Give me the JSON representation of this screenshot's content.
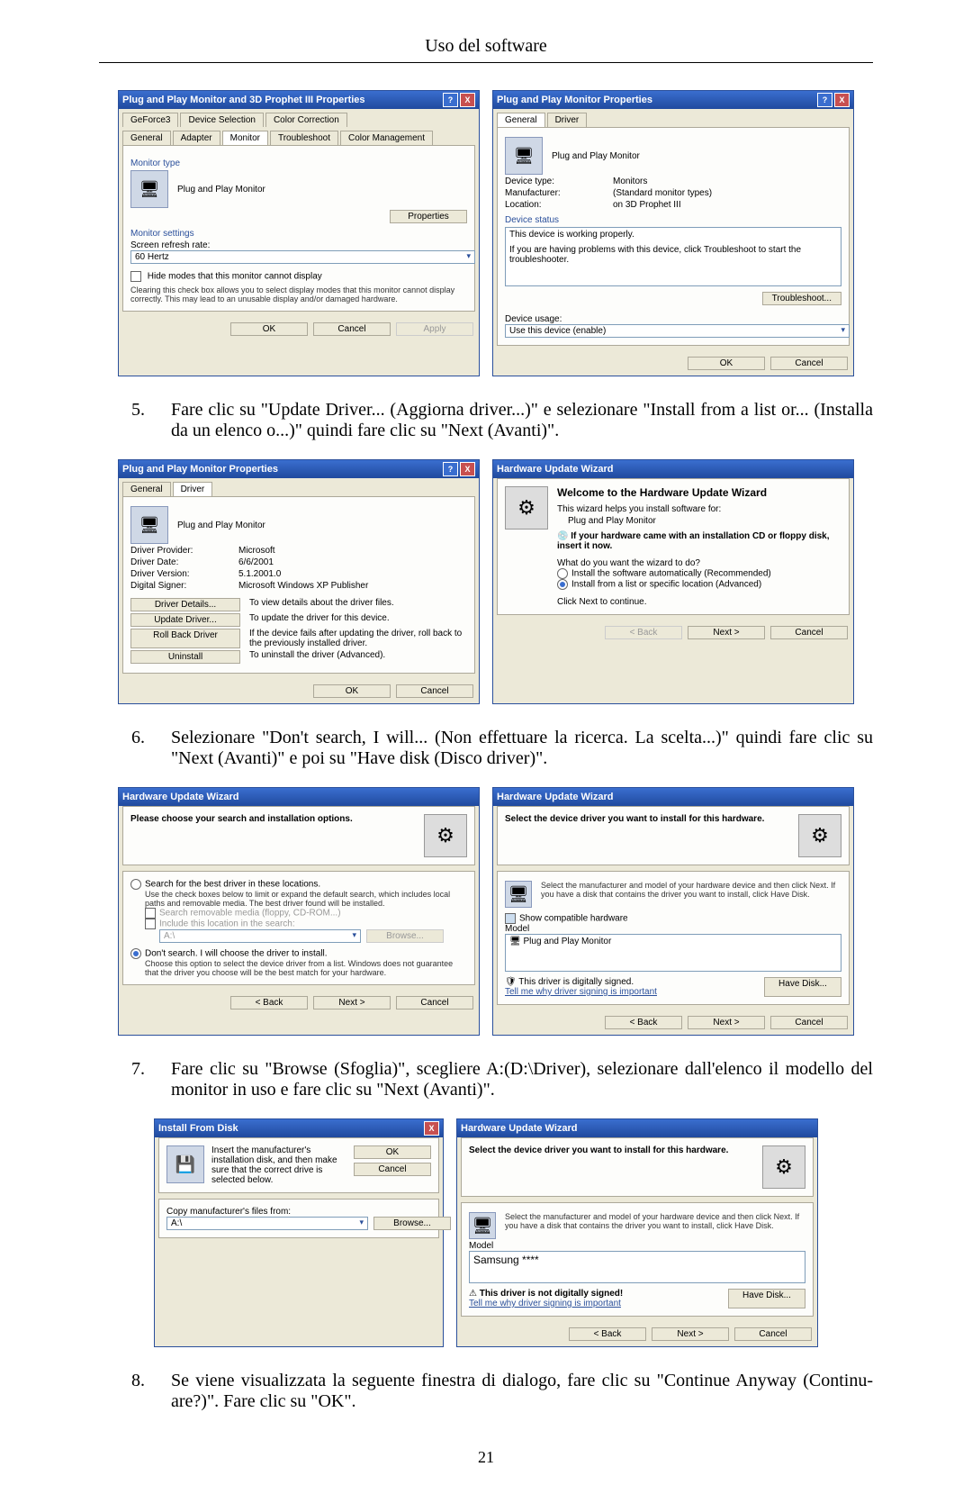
{
  "doc": {
    "header": "Uso del software",
    "page_number": "21"
  },
  "steps": {
    "s5": {
      "num": "5.",
      "text": "Fare clic su \"Update Driver... (Aggiorna driver...)\" e selezionare \"Install from a list or... (Installa da un elenco o...)\" quindi fare clic su \"Next (Avanti)\"."
    },
    "s6": {
      "num": "6.",
      "text": "Selezionare \"Don't search, I will... (Non effettuare la ricerca. La scelta...)\" quindi fare clic su \"Next (Avanti)\" e poi su \"Have disk (Disco driver)\"."
    },
    "s7": {
      "num": "7.",
      "text": "Fare clic su \"Browse (Sfoglia)\", scegliere A:(D:\\Driver), selezionare dall'elenco il modello del monitor in uso e fare clic su \"Next (Avanti)\"."
    },
    "s8": {
      "num": "8.",
      "text": "Se viene visualizzata la seguente finestra di dialogo, fare clic su \"Continue Anyway (Continu-are?)\". Fare clic su \"OK\"."
    }
  },
  "common": {
    "ok": "OK",
    "cancel": "Cancel",
    "apply": "Apply",
    "back": "< Back",
    "next": "Next >",
    "browse": "Browse...",
    "have_disk": "Have Disk...",
    "x": "X",
    "help": "?"
  },
  "win1a": {
    "title": "Plug and Play Monitor and 3D Prophet III Properties",
    "tabs_top": [
      "GeForce3",
      "Device Selection",
      "Color Correction"
    ],
    "tabs_bot": [
      "General",
      "Adapter",
      "Monitor",
      "Troubleshoot",
      "Color Management"
    ],
    "monitor_type_label": "Monitor type",
    "monitor_name": "Plug and Play Monitor",
    "properties_btn": "Properties",
    "settings_label": "Monitor settings",
    "refresh_label": "Screen refresh rate:",
    "refresh_value": "60 Hertz",
    "hide_modes": "Hide modes that this monitor cannot display",
    "hide_note": "Clearing this check box allows you to select display modes that this monitor cannot display correctly. This may lead to an unusable display and/or damaged hardware."
  },
  "win1b": {
    "title": "Plug and Play Monitor Properties",
    "tabs": [
      "General",
      "Driver"
    ],
    "device_name": "Plug and Play Monitor",
    "type_lbl": "Device type:",
    "type_val": "Monitors",
    "mfr_lbl": "Manufacturer:",
    "mfr_val": "(Standard monitor types)",
    "loc_lbl": "Location:",
    "loc_val": "on 3D Prophet III",
    "status_label": "Device status",
    "status_text": "This device is working properly.",
    "status_help": "If you are having problems with this device, click Troubleshoot to start the troubleshooter.",
    "troubleshoot": "Troubleshoot...",
    "usage_label": "Device usage:",
    "usage_value": "Use this device (enable)"
  },
  "win2a": {
    "title": "Plug and Play Monitor Properties",
    "tabs": [
      "General",
      "Driver"
    ],
    "device_name": "Plug and Play Monitor",
    "prov_lbl": "Driver Provider:",
    "prov_val": "Microsoft",
    "date_lbl": "Driver Date:",
    "date_val": "6/6/2001",
    "ver_lbl": "Driver Version:",
    "ver_val": "5.1.2001.0",
    "sign_lbl": "Digital Signer:",
    "sign_val": "Microsoft Windows XP Publisher",
    "details_btn": "Driver Details...",
    "details_txt": "To view details about the driver files.",
    "update_btn": "Update Driver...",
    "update_txt": "To update the driver for this device.",
    "roll_btn": "Roll Back Driver",
    "roll_txt": "If the device fails after updating the driver, roll back to the previously installed driver.",
    "uninst_btn": "Uninstall",
    "uninst_txt": "To uninstall the driver (Advanced)."
  },
  "win2b": {
    "title": "Hardware Update Wizard",
    "heading": "Welcome to the Hardware Update Wizard",
    "intro": "This wizard helps you install software for:",
    "device": "Plug and Play Monitor",
    "cd_hint": "If your hardware came with an installation CD or floppy disk, insert it now.",
    "question": "What do you want the wizard to do?",
    "opt1": "Install the software automatically (Recommended)",
    "opt2": "Install from a list or specific location (Advanced)",
    "click_next": "Click Next to continue."
  },
  "win3a": {
    "title": "Hardware Update Wizard",
    "heading": "Please choose your search and installation options.",
    "opt_search": "Search for the best driver in these locations.",
    "opt_search_note": "Use the check boxes below to limit or expand the default search, which includes local paths and removable media. The best driver found will be installed.",
    "chk_removable": "Search removable media (floppy, CD-ROM...)",
    "chk_include": "Include this location in the search:",
    "loc_value": "A:\\",
    "opt_dont": "Don't search. I will choose the driver to install.",
    "opt_dont_note": "Choose this option to select the device driver from a list. Windows does not guarantee that the driver you choose will be the best match for your hardware."
  },
  "win3b": {
    "title": "Hardware Update Wizard",
    "heading": "Select the device driver you want to install for this hardware.",
    "instr": "Select the manufacturer and model of your hardware device and then click Next. If you have a disk that contains the driver you want to install, click Have Disk.",
    "show_compat": "Show compatible hardware",
    "model_lbl": "Model",
    "model_val": "Plug and Play Monitor",
    "signed": "This driver is digitally signed.",
    "tell_why": "Tell me why driver signing is important"
  },
  "win4a": {
    "title": "Install From Disk",
    "instr": "Insert the manufacturer's installation disk, and then make sure that the correct drive is selected below.",
    "copy_lbl": "Copy manufacturer's files from:",
    "path": "A:\\"
  },
  "win4b": {
    "title": "Hardware Update Wizard",
    "heading": "Select the device driver you want to install for this hardware.",
    "instr": "Select the manufacturer and model of your hardware device and then click Next. If you have a disk that contains the driver you want to install, click Have Disk.",
    "model_lbl": "Model",
    "model_val": "Samsung ****",
    "not_signed": "This driver is not digitally signed!",
    "tell_why": "Tell me why driver signing is important"
  }
}
